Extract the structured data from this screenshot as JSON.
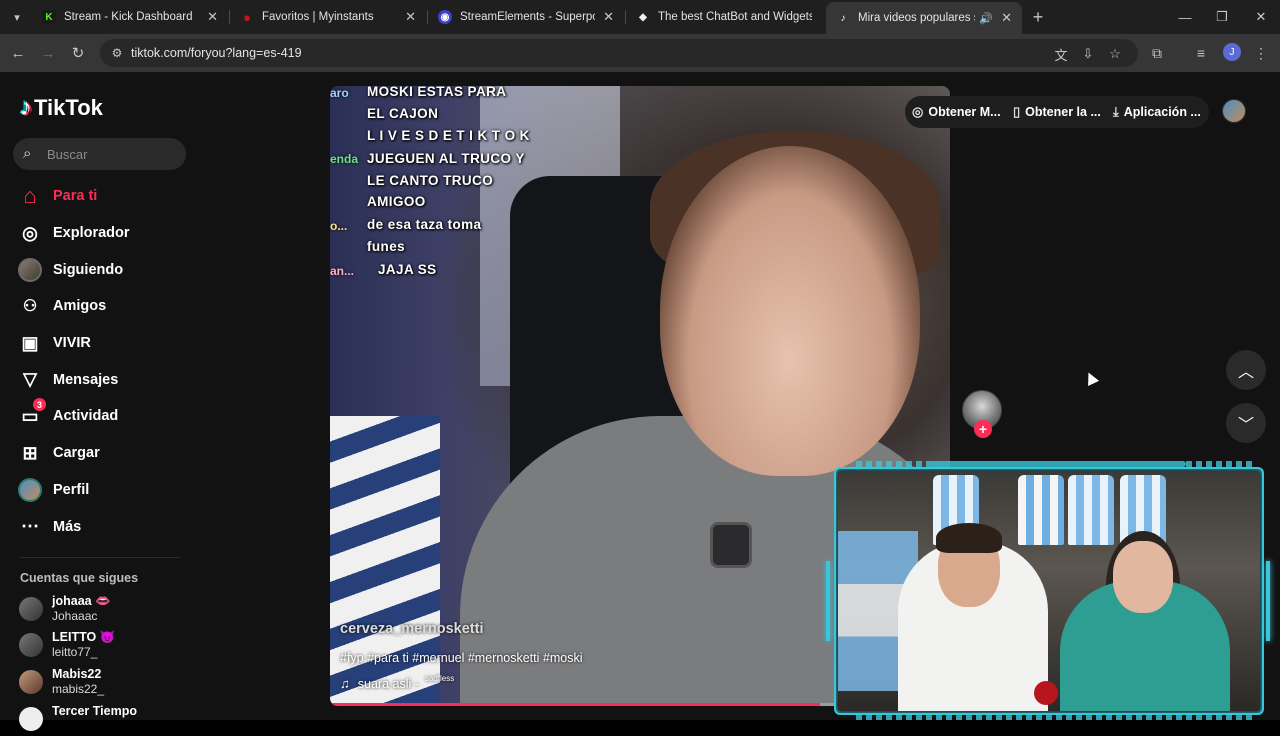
{
  "browser": {
    "tabs": [
      {
        "title": "Stream - Kick Dashboard",
        "fav_color": "#1a1a1a",
        "fav_glyph": "K",
        "fav_text": "#53fc18"
      },
      {
        "title": "Favoritos | Myinstants",
        "fav_color": "#c0161d",
        "fav_glyph": "●",
        "fav_text": "#c0161d"
      },
      {
        "title": "StreamElements - Superposición",
        "fav_color": "#3f3fd0",
        "fav_glyph": "◉",
        "fav_text": "#fff"
      },
      {
        "title": "The best ChatBot and Widgets",
        "fav_color": "#2a2a2a",
        "fav_glyph": "◆",
        "fav_text": "#eee"
      },
      {
        "title": "Mira videos populares selec",
        "fav_color": "#000",
        "fav_glyph": "♪",
        "fav_text": "#fff"
      }
    ],
    "url": "tiktok.com/foryou?lang=es-419"
  },
  "tiktok": {
    "logo_text": "TikTok",
    "search_placeholder": "Buscar",
    "nav": [
      {
        "label": "Para ti",
        "icon": "home-icon",
        "glyph": "⌂"
      },
      {
        "label": "Explorador",
        "icon": "compass-icon",
        "glyph": "◎"
      },
      {
        "label": "Siguiendo",
        "icon": "following-avatar",
        "glyph": ""
      },
      {
        "label": "Amigos",
        "icon": "friends-icon",
        "glyph": "👥"
      },
      {
        "label": "VIVIR",
        "icon": "live-icon",
        "glyph": "📺"
      },
      {
        "label": "Mensajes",
        "icon": "messages-icon",
        "glyph": "➢"
      },
      {
        "label": "Actividad",
        "icon": "activity-icon",
        "glyph": "⬚",
        "badge": "3"
      },
      {
        "label": "Cargar",
        "icon": "upload-icon",
        "glyph": "⊞"
      },
      {
        "label": "Perfil",
        "icon": "profile-avatar",
        "glyph": ""
      },
      {
        "label": "Más",
        "icon": "more-icon",
        "glyph": "···"
      }
    ],
    "following_title": "Cuentas que sigues",
    "following": [
      {
        "name": "johaaa 👄",
        "handle": "Johaaac"
      },
      {
        "name": "LEITTO 😈",
        "handle": "leitto77_"
      },
      {
        "name": "Mabis22",
        "handle": "mabis22_"
      },
      {
        "name": "Tercer Tiempo",
        "handle": ""
      }
    ],
    "top_buttons": {
      "get_coins": "Obtener M...",
      "get_app": "Obtener la ...",
      "desktop_app": "Aplicación ..."
    },
    "video": {
      "overlay_lines": [
        "MOSKI ESTAS PARA",
        "EL CAJON",
        "L I V E S D E T I K T O K",
        "JUEGUEN AL TRUCO Y",
        "LE CANTO TRUCO",
        "AMIGOO",
        "de esa taza toma",
        "funes",
        "JAJA SS"
      ],
      "overlay_left": [
        "aro",
        "enda",
        "o...",
        "an..."
      ],
      "username": "cerveza_mernosketti",
      "tags": "#fyp #para ti #mernuel #mernosketti #moski",
      "music": "suara asli -",
      "music_small": "sadfless",
      "progress_fraction": 0.79
    }
  }
}
